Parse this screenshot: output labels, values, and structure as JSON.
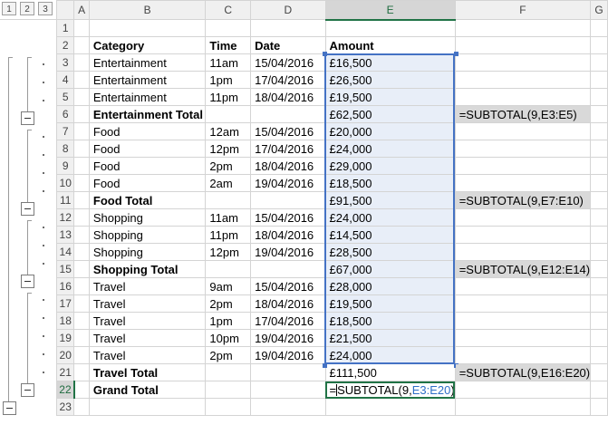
{
  "outline": {
    "levels": [
      "1",
      "2",
      "3"
    ]
  },
  "columns": [
    "A",
    "B",
    "C",
    "D",
    "E",
    "F",
    "G"
  ],
  "rows": [
    {
      "n": "1",
      "b": "",
      "c": "",
      "d": "",
      "e": "",
      "f": "",
      "bold": false
    },
    {
      "n": "2",
      "b": "Category",
      "c": "Time",
      "d": "Date",
      "e": "Amount",
      "f": "",
      "bold": true
    },
    {
      "n": "3",
      "b": "Entertainment",
      "c": "11am",
      "d": "15/04/2016",
      "e": "£16,500",
      "f": "",
      "bold": false
    },
    {
      "n": "4",
      "b": "Entertainment",
      "c": "1pm",
      "d": "17/04/2016",
      "e": "£26,500",
      "f": "",
      "bold": false
    },
    {
      "n": "5",
      "b": "Entertainment",
      "c": "11pm",
      "d": "18/04/2016",
      "e": "£19,500",
      "f": "",
      "bold": false
    },
    {
      "n": "6",
      "b": "Entertainment Total",
      "c": "",
      "d": "",
      "e": "£62,500",
      "f": "=SUBTOTAL(9,E3:E5)",
      "bold": true
    },
    {
      "n": "7",
      "b": "Food",
      "c": "12am",
      "d": "15/04/2016",
      "e": "£20,000",
      "f": "",
      "bold": false
    },
    {
      "n": "8",
      "b": "Food",
      "c": "12pm",
      "d": "17/04/2016",
      "e": "£24,000",
      "f": "",
      "bold": false
    },
    {
      "n": "9",
      "b": "Food",
      "c": "2pm",
      "d": "18/04/2016",
      "e": "£29,000",
      "f": "",
      "bold": false
    },
    {
      "n": "10",
      "b": "Food",
      "c": "2am",
      "d": "19/04/2016",
      "e": "£18,500",
      "f": "",
      "bold": false
    },
    {
      "n": "11",
      "b": "Food Total",
      "c": "",
      "d": "",
      "e": "£91,500",
      "f": "=SUBTOTAL(9,E7:E10)",
      "bold": true
    },
    {
      "n": "12",
      "b": "Shopping",
      "c": "11am",
      "d": "15/04/2016",
      "e": "£24,000",
      "f": "",
      "bold": false
    },
    {
      "n": "13",
      "b": "Shopping",
      "c": "11pm",
      "d": "18/04/2016",
      "e": "£14,500",
      "f": "",
      "bold": false
    },
    {
      "n": "14",
      "b": "Shopping",
      "c": "12pm",
      "d": "19/04/2016",
      "e": "£28,500",
      "f": "",
      "bold": false
    },
    {
      "n": "15",
      "b": "Shopping Total",
      "c": "",
      "d": "",
      "e": "£67,000",
      "f": "=SUBTOTAL(9,E12:E14)",
      "bold": true
    },
    {
      "n": "16",
      "b": "Travel",
      "c": "9am",
      "d": "15/04/2016",
      "e": "£28,000",
      "f": "",
      "bold": false
    },
    {
      "n": "17",
      "b": "Travel",
      "c": "2pm",
      "d": "18/04/2016",
      "e": "£19,500",
      "f": "",
      "bold": false
    },
    {
      "n": "18",
      "b": "Travel",
      "c": "1pm",
      "d": "17/04/2016",
      "e": "£18,500",
      "f": "",
      "bold": false
    },
    {
      "n": "19",
      "b": "Travel",
      "c": "10pm",
      "d": "19/04/2016",
      "e": "£21,500",
      "f": "",
      "bold": false
    },
    {
      "n": "20",
      "b": "Travel",
      "c": "2pm",
      "d": "19/04/2016",
      "e": "£24,000",
      "f": "",
      "bold": false
    },
    {
      "n": "21",
      "b": "Travel Total",
      "c": "",
      "d": "",
      "e": "£111,500",
      "f": "=SUBTOTAL(9,E16:E20)",
      "bold": true
    },
    {
      "n": "22",
      "b": "Grand Total",
      "c": "",
      "d": "",
      "e": "",
      "f": "",
      "bold": true
    },
    {
      "n": "23",
      "b": "",
      "c": "",
      "d": "",
      "e": "",
      "f": "",
      "bold": false
    }
  ],
  "editing_cell": {
    "prefix": "=",
    "func": "SUBTOTAL(9,",
    "range": "E3:E20",
    "suffix": ")"
  },
  "colors": {
    "selection_border": "#4472c4",
    "selection_fill": "#e8eef8",
    "formula_fill": "#d9d9d9",
    "excel_green": "#217346",
    "range_ref_blue": "#2f6fc7"
  }
}
